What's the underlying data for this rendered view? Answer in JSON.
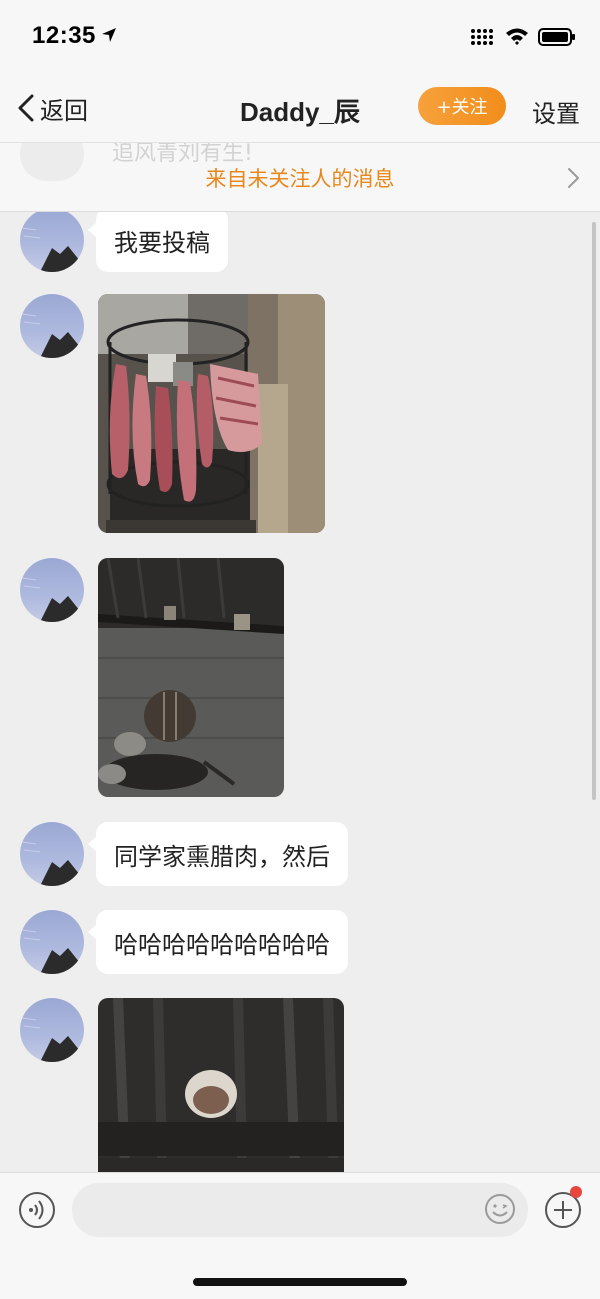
{
  "status_bar": {
    "time": "12:35"
  },
  "nav": {
    "back_label": "返回",
    "title": "Daddy_辰",
    "follow_label": "+关注",
    "settings_label": "设置"
  },
  "notice": {
    "ghost_text": "追风青刘有生!",
    "text": "来自未关注人的消息"
  },
  "messages": [
    {
      "type": "text",
      "text": "我要投稿"
    },
    {
      "type": "image",
      "alt": "photo-1"
    },
    {
      "type": "image",
      "alt": "photo-2"
    },
    {
      "type": "text",
      "text": "同学家熏腊肉，然后"
    },
    {
      "type": "text",
      "text": "哈哈哈哈哈哈哈哈哈"
    },
    {
      "type": "image",
      "alt": "photo-3"
    }
  ],
  "input": {
    "placeholder": ""
  },
  "colors": {
    "accent": "#f18d1b",
    "notice": "#e8881c",
    "badge": "#e8453c",
    "chat_bg": "#eeeeee"
  }
}
